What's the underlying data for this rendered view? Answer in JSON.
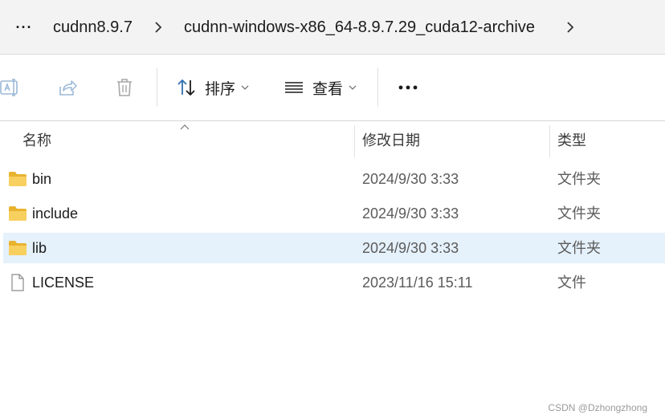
{
  "address_bar": {
    "more_label": "···",
    "segments": [
      "cudnn8.9.7",
      "cudnn-windows-x86_64-8.9.7.29_cuda12-archive"
    ]
  },
  "toolbar": {
    "rename_icon": "rename-icon",
    "share_icon": "share-icon",
    "delete_icon": "delete-icon",
    "sort_label": "排序",
    "view_label": "查看",
    "more_label": "···"
  },
  "columns": {
    "name": "名称",
    "date": "修改日期",
    "type": "类型"
  },
  "files": [
    {
      "name": "bin",
      "date": "2024/9/30 3:33",
      "type": "文件夹",
      "icon": "folder-icon",
      "selected": false
    },
    {
      "name": "include",
      "date": "2024/9/30 3:33",
      "type": "文件夹",
      "icon": "folder-icon",
      "selected": false
    },
    {
      "name": "lib",
      "date": "2024/9/30 3:33",
      "type": "文件夹",
      "icon": "folder-icon",
      "selected": true
    },
    {
      "name": "LICENSE",
      "date": "2023/11/16 15:11",
      "type": "文件",
      "icon": "file-icon",
      "selected": false
    }
  ],
  "watermark": "CSDN @Dzhongzhong",
  "colors": {
    "selection": "#e5f1fb",
    "accent": "#005fb8",
    "folder": "#f4c542"
  }
}
